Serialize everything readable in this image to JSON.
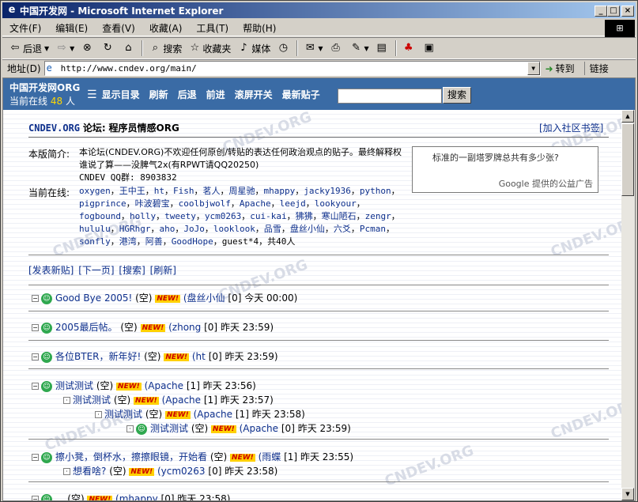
{
  "window": {
    "title": "中国开发网 - Microsoft Internet Explorer",
    "min_glyph": "_",
    "max_glyph": "□",
    "close_glyph": "×"
  },
  "menu": [
    "文件(F)",
    "编辑(E)",
    "查看(V)",
    "收藏(A)",
    "工具(T)",
    "帮助(H)"
  ],
  "toolbar": {
    "back": "后退",
    "search": "搜索",
    "favorites": "收藏夹",
    "media": "媒体"
  },
  "address": {
    "label": "地址(D)",
    "url": "http://www.cndev.org/main/",
    "go": "转到",
    "links": "链接"
  },
  "site": {
    "name": "中国开发网ORG",
    "online_label": "当前在线",
    "online_count": "48",
    "online_unit": "人",
    "nav": [
      "显示目录",
      "刷新",
      "后退",
      "前进",
      "滚屏开关",
      "最新贴子"
    ],
    "search_button": "搜索"
  },
  "forum": {
    "site_tag": "CNDEV.ORG",
    "forum_label": "论坛:",
    "forum_name": "程序员情感ORG",
    "join": "[加入社区书签]",
    "intro_label": "本版简介:",
    "intro_text": "本论坛(CNDEV.ORG)不欢迎任何原创/转贴的表达任何政治观点的贴子。最终解释权谁说了算——没脾气2x(有RPWT请QQ20250)",
    "qq_group": "CNDEV QQ群: 8903832",
    "online_label": "当前在线:",
    "online_users": [
      "oxygen",
      "王中王",
      "ht",
      "Fish",
      "茗人",
      "周星驰",
      "mhappy",
      "jacky1936",
      "python",
      "pigprince",
      "咔波碧宝",
      "coolbjwolf",
      "Apache",
      "leejd",
      "lookyour",
      "fogbound",
      "holly",
      "tweety",
      "ycm0263",
      "cui-kai",
      "狒狒",
      "寒山陋石",
      "zengr",
      "hululu",
      "HGRhgr",
      "aho",
      "JoJo",
      "looklook",
      "品雪",
      "盘丝小仙",
      "六爻",
      "Pcman",
      "sonfly",
      "港湾",
      "阿善",
      "GoodHope"
    ],
    "online_tail": "guest*4，共40人",
    "ad_question": "标准的一副塔罗牌总共有多少张?",
    "ad_footer": "Google 提供的公益广告",
    "actions": [
      "[发表新贴]",
      "[下一页]",
      "[搜索]",
      "[刷新]"
    ]
  },
  "threads": [
    {
      "title": "Good Bye 2005!",
      "empty": "(空)",
      "new": "NEW!",
      "author": "(盘丝小仙",
      "replies": "[0]",
      "time": "今天 00:00)"
    },
    {
      "title": "2005最后帖。",
      "empty": "(空)",
      "new": "NEW!",
      "author": "(zhong",
      "replies": "[0]",
      "time": "昨天 23:59)"
    },
    {
      "title": "各位BTER，新年好!",
      "empty": "(空)",
      "new": "NEW!",
      "author": "(ht",
      "replies": "[0]",
      "time": "昨天 23:59)"
    },
    {
      "title": "测试测试",
      "empty": "(空)",
      "new": "NEW!",
      "author": "(Apache",
      "replies": "[1]",
      "time": "昨天 23:56)"
    },
    {
      "title": "测试测试",
      "empty": "(空)",
      "new": "NEW!",
      "author": "(Apache",
      "replies": "[1]",
      "time": "昨天 23:57)"
    },
    {
      "title": "测试测试",
      "empty": "(空)",
      "new": "NEW!",
      "author": "(Apache",
      "replies": "[1]",
      "time": "昨天 23:58)"
    },
    {
      "title": "测试测试",
      "empty": "(空)",
      "new": "NEW!",
      "author": "(Apache",
      "replies": "[0]",
      "time": "昨天 23:59)"
    },
    {
      "title": "擦小凳，倒杯水，擦擦眼镜，开始看",
      "empty": "(空)",
      "new": "NEW!",
      "author": "(雨蝶",
      "replies": "[1]",
      "time": "昨天 23:55)"
    },
    {
      "title": "想看啥?",
      "empty": "(空)",
      "new": "NEW!",
      "author": "(ycm0263",
      "replies": "[0]",
      "time": "昨天 23:58)"
    },
    {
      "title": "...",
      "empty": "(空)",
      "new": "NEW!",
      "author": "(mhappy",
      "replies": "[0]",
      "time": "昨天 23:58)"
    }
  ],
  "watermark": "CNDEV.ORG"
}
